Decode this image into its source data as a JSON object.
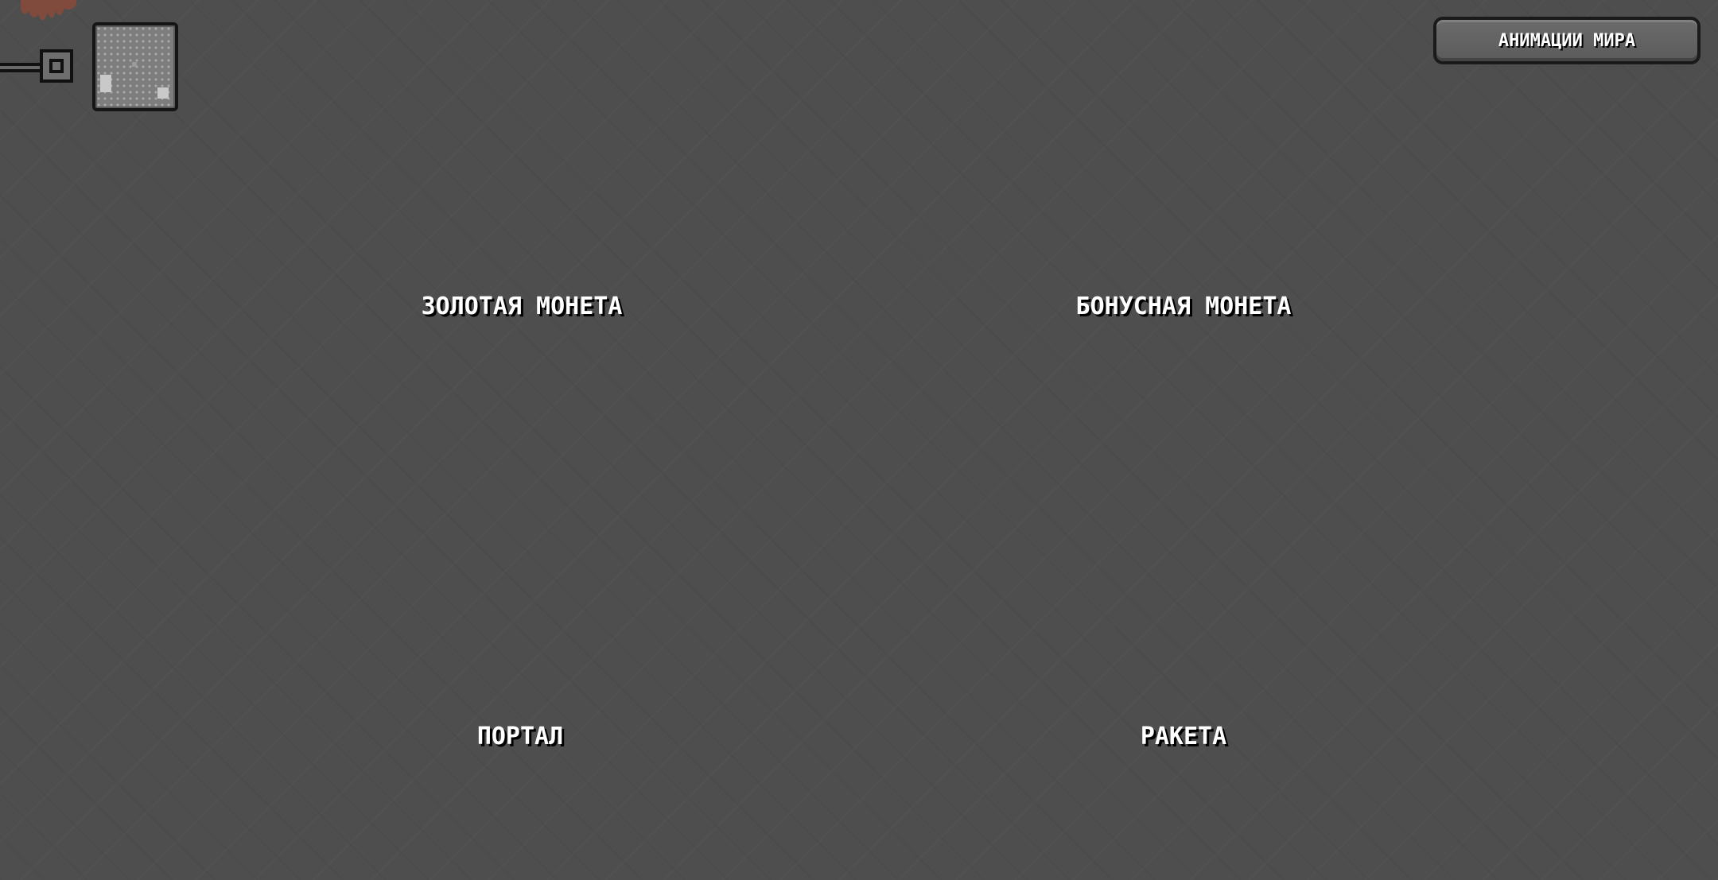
{
  "hud": {
    "world_animations_button": "АНИМАЦИИ МИРА",
    "minimap_icon": "minimap-icon",
    "paint_blob_color": "#8a4a3a"
  },
  "animations": [
    {
      "label": "ЗОЛОТАЯ МОНЕТА"
    },
    {
      "label": "БОНУСНАЯ МОНЕТА"
    },
    {
      "label": "ПОРТАЛ"
    },
    {
      "label": "РАКЕТА"
    }
  ],
  "colors": {
    "background": "#4e4e4e",
    "button_fill": "#636363",
    "button_border": "#1a1a1a",
    "text": "#ffffff",
    "text_shadow": "#000000"
  }
}
